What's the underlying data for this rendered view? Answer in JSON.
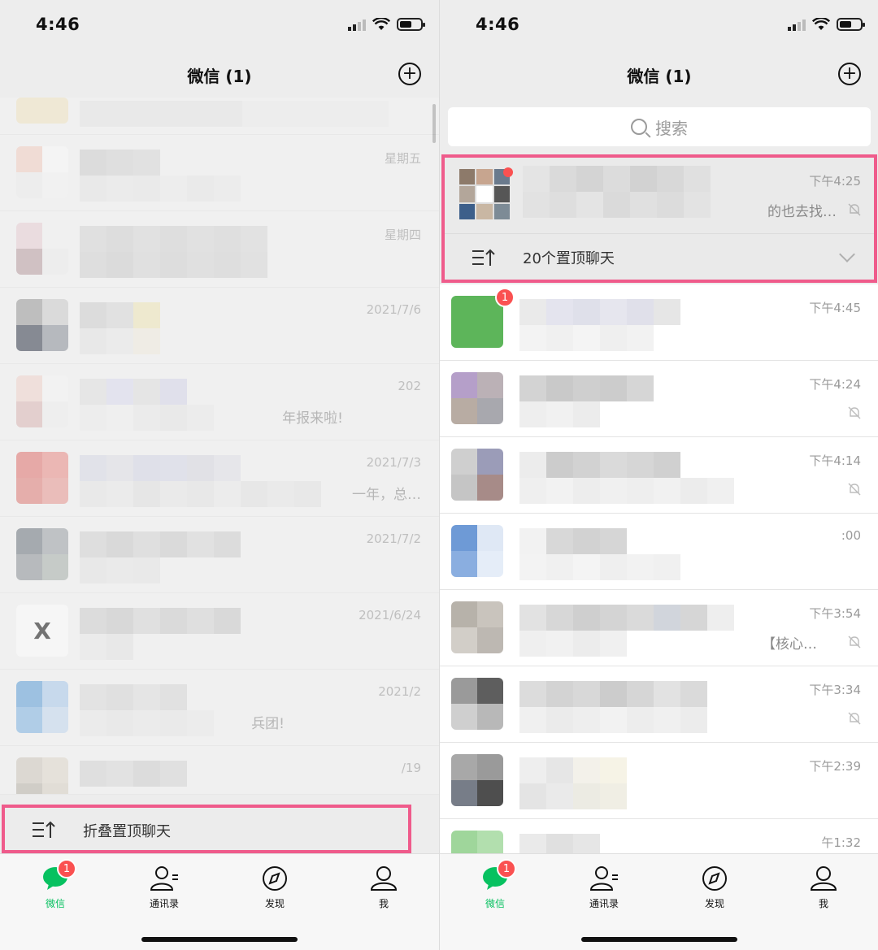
{
  "left": {
    "status": {
      "time": "4:46"
    },
    "nav": {
      "title": "微信 (1)"
    },
    "rows": [
      {
        "time": "",
        "msg": ""
      },
      {
        "time": "星期五",
        "msg": ""
      },
      {
        "time": "星期四",
        "msg": ""
      },
      {
        "time": "2021/7/6",
        "msg": ""
      },
      {
        "time": "202",
        "msg": "年报来啦!"
      },
      {
        "time": "2021/7/3",
        "msg": "一年，总…"
      },
      {
        "time": "2021/7/2",
        "msg": ""
      },
      {
        "time": "2021/6/24",
        "msg": ""
      },
      {
        "time": "2021/2",
        "msg": "兵团!"
      },
      {
        "time": "/19",
        "msg": ""
      }
    ],
    "collapse_label": "折叠置顶聊天",
    "tabs": [
      {
        "label": "微信",
        "badge": "1"
      },
      {
        "label": "通讯录"
      },
      {
        "label": "发现"
      },
      {
        "label": "我"
      }
    ]
  },
  "right": {
    "status": {
      "time": "4:46"
    },
    "nav": {
      "title": "微信 (1)"
    },
    "search": {
      "placeholder": "搜索"
    },
    "pinned": {
      "time": "下午4:25",
      "msg": "的也去找…",
      "fold_label": "20个置顶聊天"
    },
    "rows": [
      {
        "time": "下午4:45",
        "msg": "",
        "badge": "1"
      },
      {
        "time": "下午4:24",
        "msg": ""
      },
      {
        "time": "下午4:14",
        "msg": ""
      },
      {
        "time": ":00",
        "msg": ""
      },
      {
        "time": "下午3:54",
        "msg": "【核心…"
      },
      {
        "time": "下午3:34",
        "msg": ""
      },
      {
        "time": "下午2:39",
        "msg": ""
      },
      {
        "time": "午1:32",
        "msg": ""
      }
    ],
    "tabs": [
      {
        "label": "微信",
        "badge": "1"
      },
      {
        "label": "通讯录"
      },
      {
        "label": "发现"
      },
      {
        "label": "我"
      }
    ]
  },
  "colors": {
    "accent": "#07c160",
    "highlight": "#ef5b8b",
    "badge": "#fa5151"
  }
}
